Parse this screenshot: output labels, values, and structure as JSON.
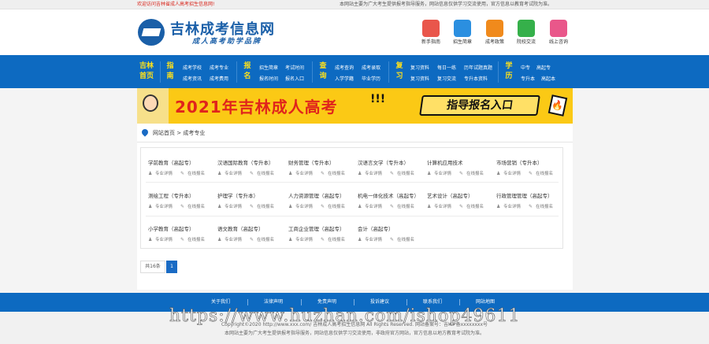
{
  "topbar": {
    "welcome": "欢迎访问吉林省成人高考招生信息网!",
    "notice": "本网站主要为广大考生提供报考指导服务，网站信息仅供学习交流使用，官方信息以教育考试院为准。"
  },
  "logo": {
    "title": "吉林成考信息网",
    "subtitle": "成人高考助学品牌"
  },
  "quick_links": [
    {
      "label": "新手指南",
      "icon": "home-icon",
      "color": "#e9564b"
    },
    {
      "label": "招生简章",
      "icon": "building-icon",
      "color": "#2b8fe0"
    },
    {
      "label": "成考政策",
      "icon": "document-icon",
      "color": "#f08a1c"
    },
    {
      "label": "院校交流",
      "icon": "chat-icon",
      "color": "#35b04a"
    },
    {
      "label": "线上咨询",
      "icon": "headset-icon",
      "color": "#e9578a"
    }
  ],
  "nav": {
    "home": [
      "吉林",
      "首页"
    ],
    "groups": [
      {
        "cat": [
          "指",
          "南"
        ],
        "row1": [
          "成考学校",
          "成考专业"
        ],
        "row2": [
          "成考资讯",
          "成考费用"
        ]
      },
      {
        "cat": [
          "报",
          "名"
        ],
        "row1": [
          "招生简章",
          "考试时间"
        ],
        "row2": [
          "报名时间",
          "报名入口"
        ]
      },
      {
        "cat": [
          "查",
          "询"
        ],
        "row1": [
          "成考查询",
          "成考录取"
        ],
        "row2": [
          "入学学籍",
          "毕业学历"
        ]
      },
      {
        "cat": [
          "复",
          "习"
        ],
        "row1": [
          "复习资料",
          "每日一练",
          "历年试题真题"
        ],
        "row2": [
          "复习资料",
          "复习交流",
          "专升本资料"
        ]
      },
      {
        "cat": [
          "学",
          "历"
        ],
        "row1": [
          "中专",
          "高起专"
        ],
        "row2": [
          "专升本",
          "高起本"
        ]
      }
    ]
  },
  "banner": {
    "title": "2021年吉林成人高考",
    "exclaim": "!!!",
    "button": "指导报名入口"
  },
  "breadcrumb": "网站首页 > 成考专业",
  "majors": [
    {
      "name": "学前教育（高起专）",
      "detail": "专业详情",
      "apply": "在线报名"
    },
    {
      "name": "汉语国际教育（专升本）",
      "detail": "专业详情",
      "apply": "在线报名"
    },
    {
      "name": "财务管理（专升本）",
      "detail": "专业详情",
      "apply": "在线报名"
    },
    {
      "name": "汉语言文学（专升本）",
      "detail": "专业详情",
      "apply": "在线报名"
    },
    {
      "name": "计算机应用技术",
      "detail": "专业详情",
      "apply": "在线报名"
    },
    {
      "name": "市场营销（专升本）",
      "detail": "专业详情",
      "apply": "在线报名"
    },
    {
      "name": "测绘工程（专升本）",
      "detail": "专业详情",
      "apply": "在线报名"
    },
    {
      "name": "护理学（专升本）",
      "detail": "专业详情",
      "apply": "在线报名"
    },
    {
      "name": "人力资源管理（高起专）",
      "detail": "专业详情",
      "apply": "在线报名"
    },
    {
      "name": "机电一体化技术（高起专）",
      "detail": "专业详情",
      "apply": "在线报名"
    },
    {
      "name": "艺术设计（高起专）",
      "detail": "专业详情",
      "apply": "在线报名"
    },
    {
      "name": "行政管理管理（高起专）",
      "detail": "专业详情",
      "apply": "在线报名"
    },
    {
      "name": "小学教育（高起专）",
      "detail": "专业详情",
      "apply": "在线报名"
    },
    {
      "name": "语文教育（高起专）",
      "detail": "专业详情",
      "apply": "在线报名"
    },
    {
      "name": "工商企业管理（高起专）",
      "detail": "专业详情",
      "apply": "在线报名"
    },
    {
      "name": "会计（高起专）",
      "detail": "专业详情",
      "apply": "在线报名"
    }
  ],
  "pager": {
    "total": "共16条",
    "current": "1"
  },
  "footer": {
    "links": [
      "关于我们",
      "法律声明",
      "免责声明",
      "投诉建议",
      "联系我们",
      "网站地图"
    ],
    "copyright": "Copyright©2020 http://www.xxx.com/ 吉林成人高考招生信息网 All Rights Reserved. 网站备案号：吉ICP备xxxxxxxx号",
    "disclaimer": "本网站主要为广大考生提供报考指导服务，网站信息仅供学习交流使用，非政府官方网站，官方信息以地方教育考试院为准。"
  },
  "watermark": "https://www.huzhan.com/ishop49611"
}
